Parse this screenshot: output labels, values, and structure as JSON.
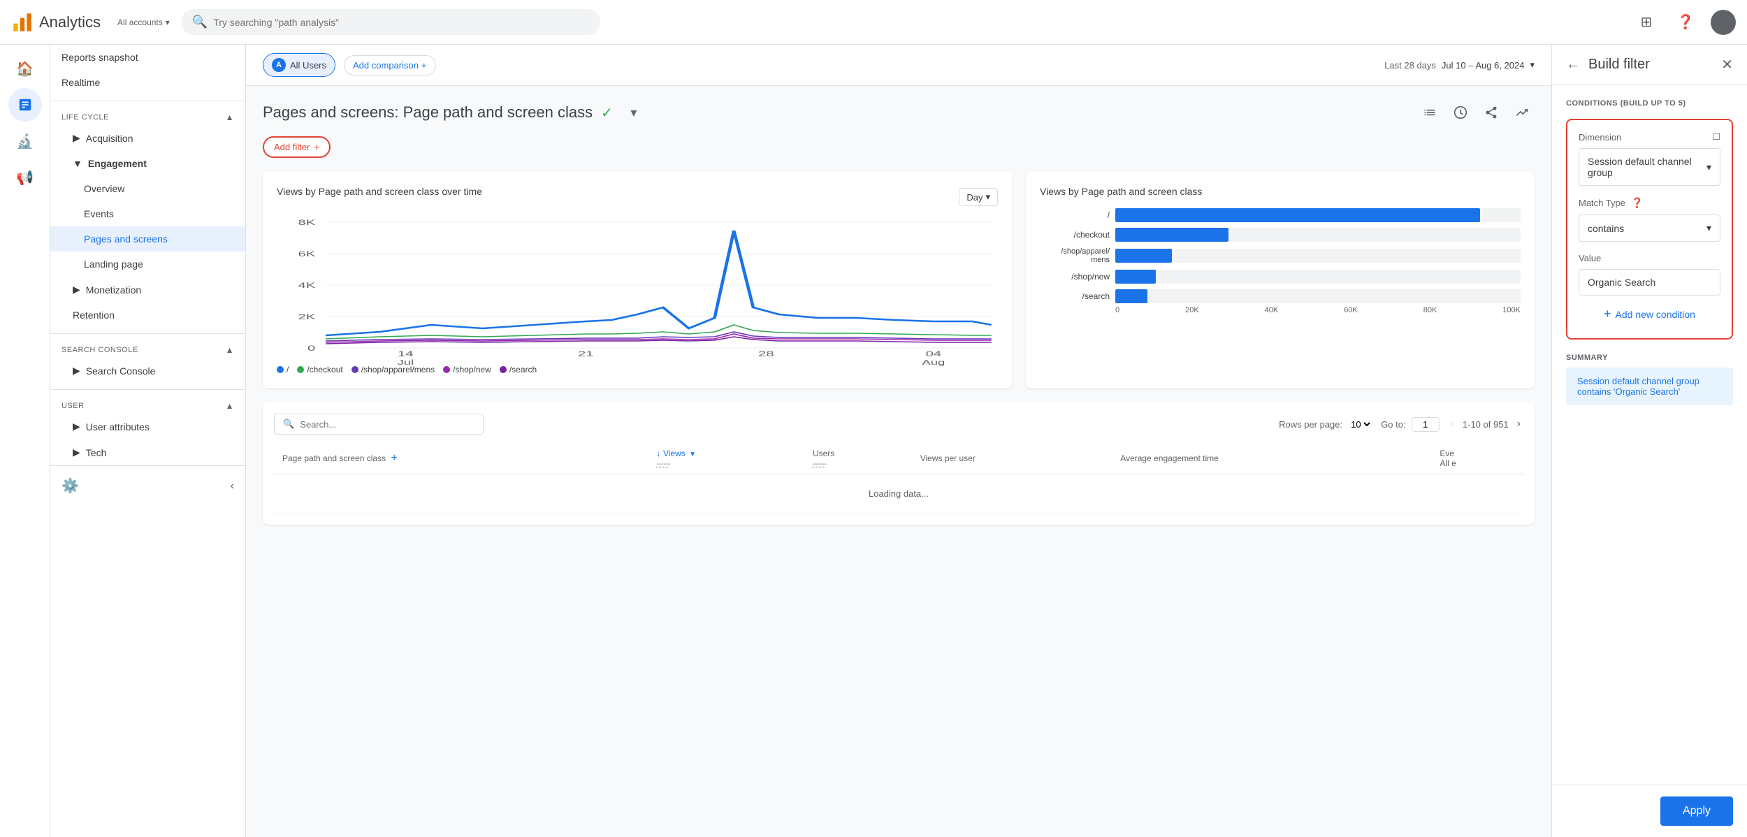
{
  "app": {
    "title": "Analytics",
    "account": "All accounts",
    "search_placeholder": "Try searching \"path analysis\""
  },
  "header": {
    "comparison": "All Users",
    "comparison_letter": "A",
    "add_comparison": "Add comparison",
    "date_label": "Last 28 days",
    "date_range": "Jul 10 – Aug 6, 2024"
  },
  "page": {
    "title": "Pages and screens: Page path and screen class",
    "filter_btn": "Add filter"
  },
  "sidebar": {
    "reports_snapshot": "Reports snapshot",
    "realtime": "Realtime",
    "lifecycle_label": "Life cycle",
    "acquisition": "Acquisition",
    "engagement": "Engagement",
    "overview": "Overview",
    "events": "Events",
    "pages_and_screens": "Pages and screens",
    "landing_page": "Landing page",
    "monetization": "Monetization",
    "retention": "Retention",
    "search_console_label": "Search Console",
    "search_console": "Search Console",
    "user_label": "User",
    "user_attributes": "User attributes",
    "tech": "Tech",
    "settings": "Settings",
    "collapse": "Collapse"
  },
  "line_chart": {
    "title": "Views by Page path and screen class over time",
    "day_select": "Day",
    "y_labels": [
      "8K",
      "6K",
      "4K",
      "2K",
      "0"
    ],
    "x_labels": [
      "14\nJul",
      "21",
      "28",
      "04\nAug"
    ],
    "legend": [
      {
        "label": "/",
        "color": "#1a73e8"
      },
      {
        "label": "/checkout",
        "color": "#34a853"
      },
      {
        "label": "/shop/apparel/mens",
        "color": "#673ab7"
      },
      {
        "label": "/shop/new",
        "color": "#9c27b0"
      },
      {
        "label": "/search",
        "color": "#7b1fa2"
      }
    ]
  },
  "bar_chart": {
    "title": "Views by Page path and screen class",
    "bars": [
      {
        "label": "/",
        "value": 90,
        "display": ""
      },
      {
        "label": "/checkout",
        "value": 28,
        "display": ""
      },
      {
        "label": "/shop/apparel/\nmens",
        "value": 14,
        "display": ""
      },
      {
        "label": "/shop/new",
        "value": 10,
        "display": ""
      },
      {
        "label": "/search",
        "value": 8,
        "display": ""
      }
    ],
    "x_axis": [
      "0",
      "20K",
      "40K",
      "60K",
      "80K",
      "100K"
    ]
  },
  "table": {
    "search_placeholder": "Search...",
    "rows_per_page_label": "Rows per page:",
    "rows_per_page": "10",
    "goto_label": "Go to:",
    "goto_value": "1",
    "pagination": "1-10 of 951",
    "columns": [
      {
        "label": "Page path and screen class",
        "sort": false
      },
      {
        "label": "↓ Views",
        "sort": true
      },
      {
        "label": "Users",
        "sort": false
      },
      {
        "label": "Views per user",
        "sort": false
      },
      {
        "label": "Average engagement time",
        "sort": false
      },
      {
        "label": "Eve\nAll e",
        "sort": false
      }
    ]
  },
  "filter_panel": {
    "title": "Build filter",
    "conditions_label": "CONDITIONS (BUILD UP TO 5)",
    "dimension_label": "Dimension",
    "dimension_value": "Session default channel group",
    "match_type_label": "Match Type",
    "match_type_value": "contains",
    "value_label": "Value",
    "value": "Organic Search",
    "add_condition": "Add new condition",
    "summary_label": "SUMMARY",
    "summary_text": "Session default channel group contains 'Organic Search'",
    "apply_btn": "Apply"
  }
}
